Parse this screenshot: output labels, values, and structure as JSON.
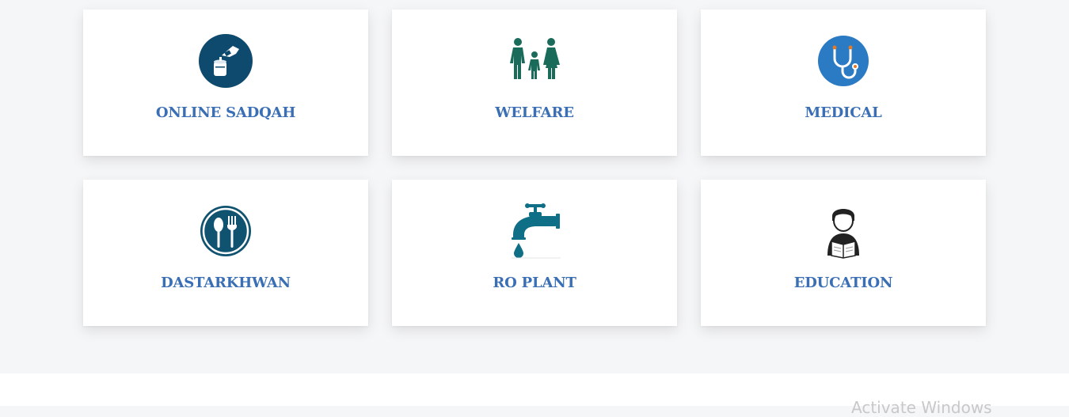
{
  "cards": [
    {
      "label": "ONLINE SADQAH",
      "icon": "donation-icon",
      "color": "#0d4a6e"
    },
    {
      "label": "WELFARE",
      "icon": "family-icon",
      "color": "#1a6b5a"
    },
    {
      "label": "MEDICAL",
      "icon": "stethoscope-icon",
      "color": "#2a7bc4"
    },
    {
      "label": "DASTARKHWAN",
      "icon": "spoon-fork-icon",
      "color": "#0f5370"
    },
    {
      "label": "RO PLANT",
      "icon": "water-tap-icon",
      "color": "#0e6f86"
    },
    {
      "label": "EDUCATION",
      "icon": "student-reading-icon",
      "color": "#222222"
    }
  ],
  "label_color": "#3a6fb5",
  "watermark": "Activate Windows"
}
